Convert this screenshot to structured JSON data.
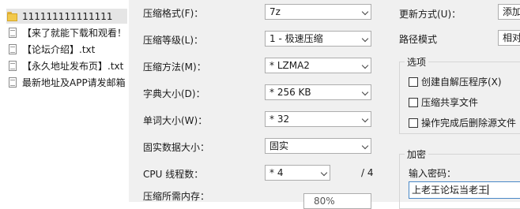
{
  "file_list": {
    "items": [
      {
        "name": "111111111111111",
        "icon": "folder-icon",
        "selected": true
      },
      {
        "name": "【来了就能下载和观看！",
        "icon": "text-file-icon"
      },
      {
        "name": "【论坛介绍】.txt",
        "icon": "text-file-icon"
      },
      {
        "name": "【永久地址发布页】.txt",
        "icon": "text-file-icon"
      },
      {
        "name": "最新地址及APP请发邮箱",
        "icon": "text-file-icon"
      }
    ]
  },
  "compression": {
    "format_label": "压缩格式(F)：",
    "format_value": "7z",
    "level_label": "压缩等级(L)：",
    "level_value": "1 - 极速压缩",
    "method_label": "压缩方法(M)：",
    "method_value": "* LZMA2",
    "dict_label": "字典大小(D)：",
    "dict_value": "* 256 KB",
    "word_label": "单词大小(W)：",
    "word_value": "* 32",
    "solid_label": "固实数据大小：",
    "solid_value": "固实",
    "cpu_label": "CPU 线程数：",
    "cpu_value": "* 4",
    "cpu_total": "/ 4",
    "memory_label": "压缩所需内存：",
    "memory_value": "80%"
  },
  "update": {
    "mode_label": "更新方式(U)：",
    "mode_value": "添加",
    "path_label": "路径模式",
    "path_value": "相对"
  },
  "options": {
    "title": "选项",
    "sfx_label": "创建自解压程序(X)",
    "shared_label": "压缩共享文件",
    "delete_label": "操作完成后删除源文件"
  },
  "encryption": {
    "title": "加密",
    "password_label": "输入密码：",
    "password_value": "上老王论坛当老王"
  },
  "colors": {
    "panel_bg": "#f0f0f0",
    "selected_row": "#e5e5e5",
    "focus_border": "#4a88c7"
  }
}
